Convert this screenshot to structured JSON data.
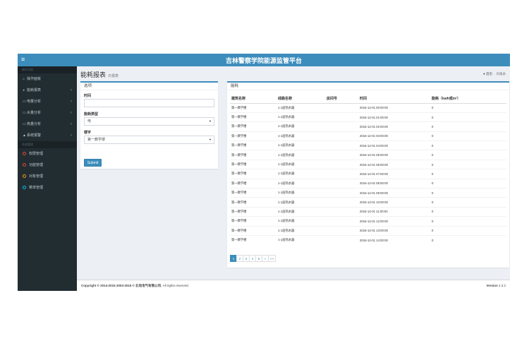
{
  "header": {
    "title": "吉林警察学院能源监管平台",
    "menu_icon": "≡"
  },
  "sidebar": {
    "section1": "操作导航",
    "items": [
      {
        "label": "操作面板",
        "icon": "home-icon",
        "chev": ""
      },
      {
        "label": "能耗报表",
        "icon": "pie-chart-icon",
        "chev": "‹"
      },
      {
        "label": "电量分析",
        "icon": "monitor-icon",
        "chev": "‹"
      },
      {
        "label": "水量分析",
        "icon": "monitor-icon",
        "chev": "‹"
      },
      {
        "label": "热量分析",
        "icon": "monitor-icon",
        "chev": "‹"
      },
      {
        "label": "系统报警",
        "icon": "area-chart-icon",
        "chev": "‹"
      }
    ],
    "section2": "系统管理",
    "admin": [
      {
        "label": "权限管理",
        "color": "#dd4b39"
      },
      {
        "label": "功能管理",
        "color": "#dd4b39"
      },
      {
        "label": "对象管理",
        "color": "#f39c12"
      },
      {
        "label": "菜单管理",
        "color": "#00c0ef"
      }
    ]
  },
  "page": {
    "title": "能耗报表",
    "subtitle": "日报表"
  },
  "breadcrumb": {
    "home": "首页",
    "sep": "›",
    "current": "日报表"
  },
  "options": {
    "title": "选项",
    "time_label": "时间",
    "time_value": "",
    "type_label": "能耗类型",
    "type_value": "电",
    "building_label": "楼宇",
    "building_value": "第一教学楼",
    "submit": "Submit"
  },
  "energy": {
    "title": "能耗",
    "columns": [
      "建筑名称",
      "线路名称",
      "房间号",
      "时间",
      "能耗（kwh或m³）"
    ],
    "rows": [
      [
        "第一教学楼",
        "1-1层热水器",
        "",
        "2016-12-01 00:00:00",
        "0"
      ],
      [
        "第一教学楼",
        "1-1层热水器",
        "",
        "2016-12-01 01:00:00",
        "0"
      ],
      [
        "第一教学楼",
        "1-1层热水器",
        "",
        "2016-12-01 02:00:00",
        "0"
      ],
      [
        "第一教学楼",
        "1-1层热水器",
        "",
        "2016-12-01 03:00:00",
        "0"
      ],
      [
        "第一教学楼",
        "1-1层热水器",
        "",
        "2016-12-01 04:00:00",
        "0"
      ],
      [
        "第一教学楼",
        "1-1层热水器",
        "",
        "2016-12-01 05:00:00",
        "0"
      ],
      [
        "第一教学楼",
        "1-1层热水器",
        "",
        "2016-12-01 06:00:00",
        "0"
      ],
      [
        "第一教学楼",
        "1-1层热水器",
        "",
        "2016-12-01 07:00:00",
        "0"
      ],
      [
        "第一教学楼",
        "1-1层热水器",
        "",
        "2016-12-01 08:00:00",
        "0"
      ],
      [
        "第一教学楼",
        "1-1层热水器",
        "",
        "2016-12-01 09:00:00",
        "0"
      ],
      [
        "第一教学楼",
        "1-1层热水器",
        "",
        "2016-12-01 10:00:00",
        "0"
      ],
      [
        "第一教学楼",
        "1-1层热水器",
        "",
        "2016-12-01 11:00:00",
        "0"
      ],
      [
        "第一教学楼",
        "1-1层热水器",
        "",
        "2016-12-01 12:00:00",
        "0"
      ],
      [
        "第一教学楼",
        "1-1层热水器",
        "",
        "2016-12-01 13:00:00",
        "0"
      ],
      [
        "第一教学楼",
        "1-1层热水器",
        "",
        "2016-12-01 14:00:00",
        "0"
      ]
    ]
  },
  "pagination": {
    "pages": [
      "1",
      "2",
      "3",
      "4",
      "5",
      "»",
      "»»"
    ],
    "active": "1"
  },
  "footer": {
    "copyright_prefix": "Copyright © 2014-2015 2003-2015 © ",
    "company": "北电电气有限公司.",
    "rights": " All rights reserved.",
    "version_label": "Version",
    "version": "2.3.2"
  }
}
